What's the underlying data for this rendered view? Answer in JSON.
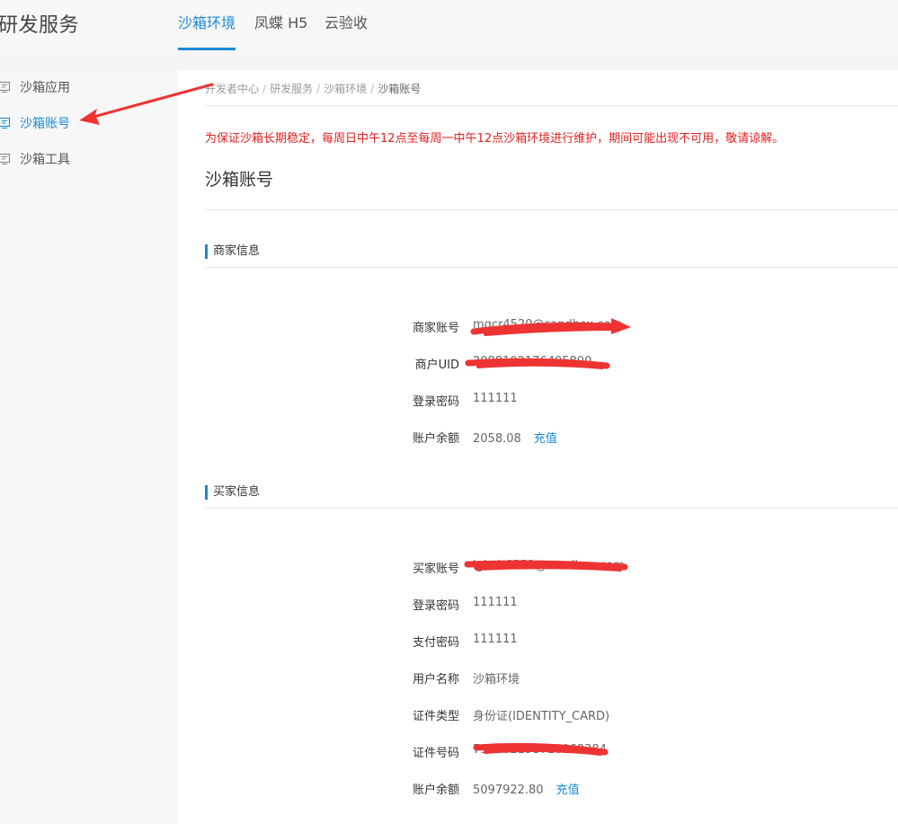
{
  "header": {
    "brand": "研发服务",
    "tabs": [
      {
        "label": "沙箱环境"
      },
      {
        "label": "凤蝶 H5"
      },
      {
        "label": "云验收"
      }
    ]
  },
  "sidebar": {
    "items": [
      {
        "label": "沙箱应用"
      },
      {
        "label": "沙箱账号"
      },
      {
        "label": "沙箱工具"
      }
    ]
  },
  "breadcrumb": [
    "开发者中心",
    "研发服务",
    "沙箱环境",
    "沙箱账号"
  ],
  "notice": "为保证沙箱长期稳定，每周日中午12点至每周一中午12点沙箱环境进行维护，期间可能出现不可用，敬请谅解。",
  "page_title": "沙箱账号",
  "merchant": {
    "section_title": "商家信息",
    "rows": [
      {
        "label": "商家账号",
        "value": "mqcr4520@sandbox.com"
      },
      {
        "label": "商户UID",
        "value": "2088102176405800"
      },
      {
        "label": "登录密码",
        "value": "111111"
      },
      {
        "label": "账户余额",
        "value": "2058.08",
        "link": "充值"
      }
    ]
  },
  "buyer": {
    "section_title": "买家信息",
    "rows": [
      {
        "label": "买家账号",
        "value": "lgkxir6552@sandbox.com"
      },
      {
        "label": "登录密码",
        "value": "111111"
      },
      {
        "label": "支付密码",
        "value": "111111"
      },
      {
        "label": "用户名称",
        "value": "沙箱环境"
      },
      {
        "label": "证件类型",
        "value": "身份证(IDENTITY_CARD)"
      },
      {
        "label": "证件号码",
        "value": "793502198710068384"
      },
      {
        "label": "账户余额",
        "value": "5097922.80",
        "link": "充值"
      }
    ]
  },
  "colors": {
    "accent": "#1b8ad6",
    "notice": "#e02020",
    "annotation": "#ee3333"
  }
}
